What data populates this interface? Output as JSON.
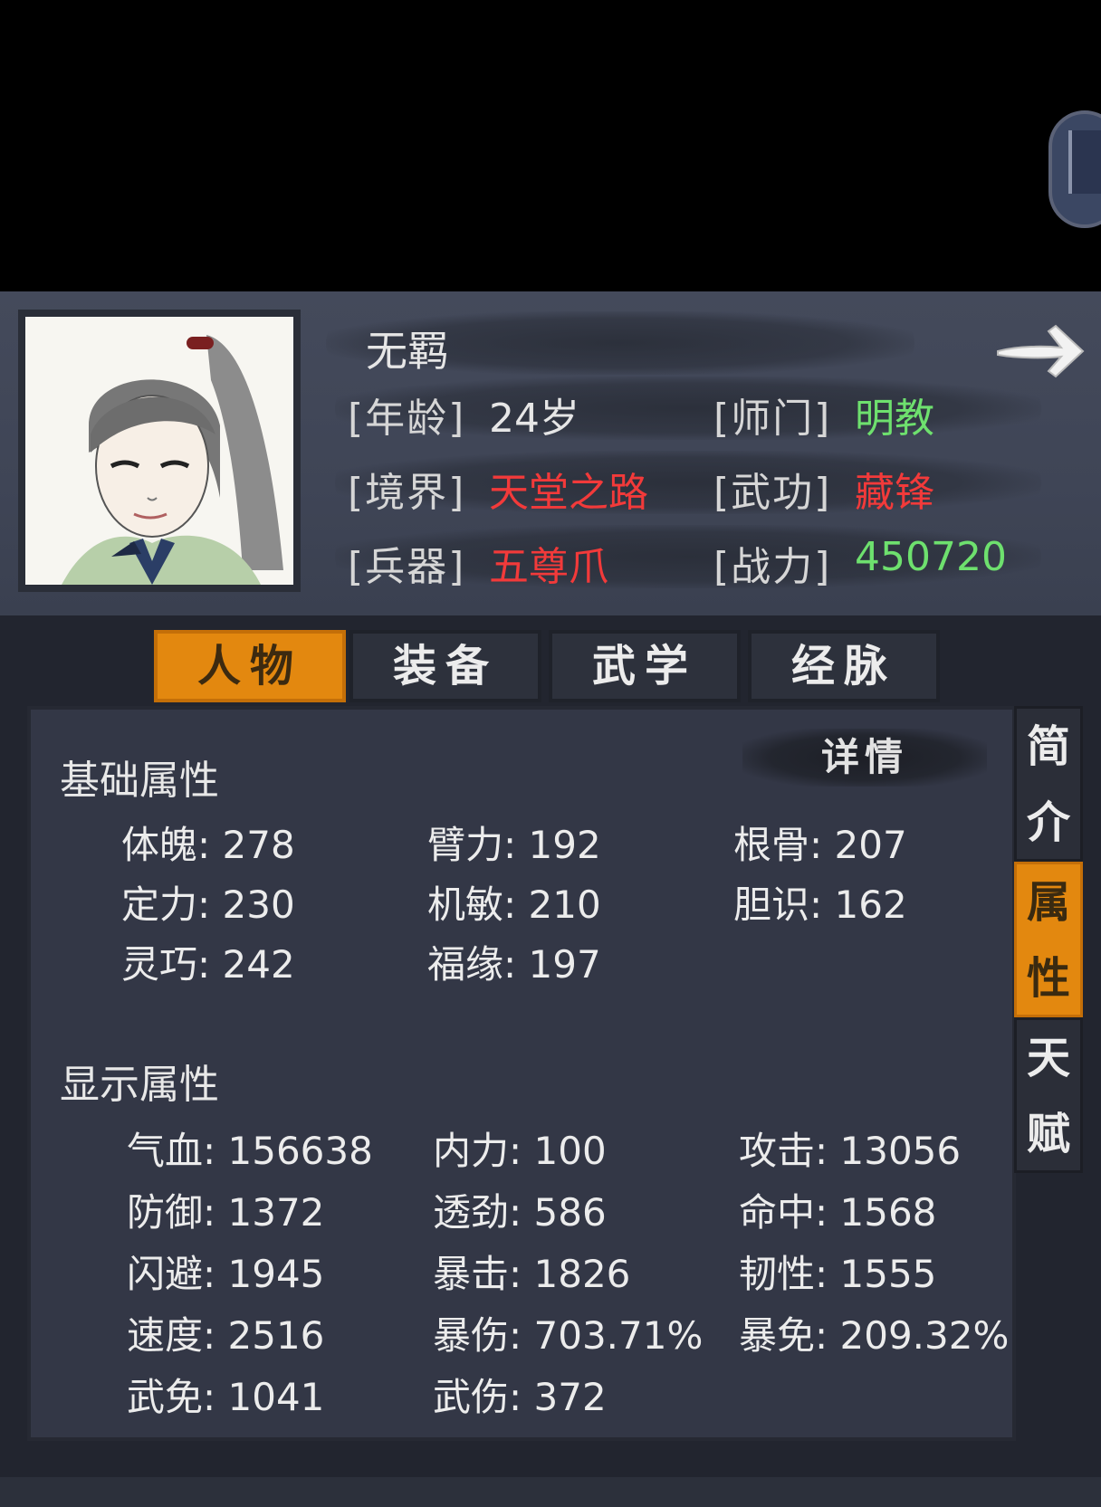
{
  "character": {
    "name": "无羁",
    "age_label": "[年龄]",
    "age_value": "24岁",
    "sect_label": "[师门]",
    "sect_value": "明教",
    "realm_label": "[境界]",
    "realm_value": "天堂之路",
    "martial_label": "[武功]",
    "martial_value": "藏锋",
    "weapon_label": "[兵器]",
    "weapon_value": "五尊爪",
    "power_label": "[战力]",
    "power_value": "450720"
  },
  "tabs": [
    {
      "label": "人物",
      "active": true
    },
    {
      "label": "装备",
      "active": false
    },
    {
      "label": "武学",
      "active": false
    },
    {
      "label": "经脉",
      "active": false
    }
  ],
  "side_tabs": [
    {
      "label": "简介",
      "active": false
    },
    {
      "label": "属性",
      "active": true
    },
    {
      "label": "天赋",
      "active": false
    }
  ],
  "detail_button": "详情",
  "basic": {
    "title": "基础属性",
    "stats": [
      "体魄: 278",
      "臂力: 192",
      "根骨: 207",
      "定力: 230",
      "机敏: 210",
      "胆识: 162",
      "灵巧: 242",
      "福缘: 197"
    ]
  },
  "display": {
    "title": "显示属性",
    "stats": [
      "气血: 156638",
      "内力: 100",
      "攻击: 13056",
      "防御: 1372",
      "透劲: 586",
      "命中: 1568",
      "闪避: 1945",
      "暴击: 1826",
      "韧性: 1555",
      "速度: 2516",
      "暴伤: 703.71%",
      "暴免: 209.32%",
      "武免: 1041",
      "武伤: 372"
    ]
  },
  "colors": {
    "accent_orange": "#e3880f",
    "value_green": "#6ee06e",
    "value_red": "#f23a3a"
  }
}
